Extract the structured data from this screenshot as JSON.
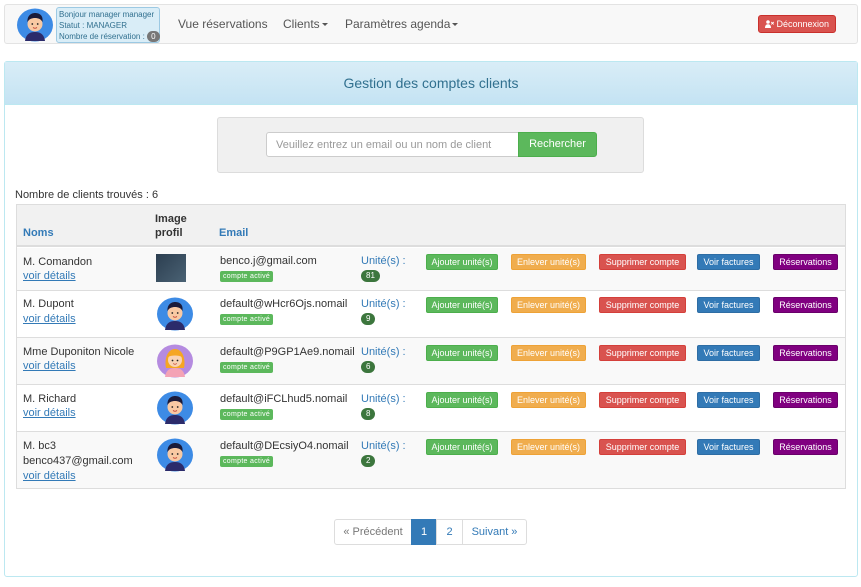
{
  "nav": {
    "greeting": "Bonjour manager manager",
    "status": "Statut : MANAGER",
    "reservations_label": "Nombre de réservation :",
    "reservations_count": "0",
    "link_reservations": "Vue réservations",
    "link_clients": "Clients",
    "link_agenda": "Paramètres agenda",
    "logout": "Déconnexion"
  },
  "panel": {
    "title": "Gestion des comptes clients"
  },
  "search": {
    "placeholder": "Veuillez entrez un email ou un nom de client",
    "button": "Rechercher"
  },
  "results": {
    "count_text": "Nombre de clients trouvés : 6"
  },
  "table": {
    "headers": {
      "name": "Noms",
      "image_line1": "Image",
      "image_line2": "profil",
      "email": "Email"
    },
    "units_label": "Unité(s) :",
    "details_link": "voir détails",
    "active_badge": "compte activé",
    "actions": {
      "add": "Ajouter unité(s)",
      "remove": "Enlever unité(s)",
      "delete": "Supprimer compte",
      "invoices": "Voir factures",
      "reservations": "Réservations"
    },
    "rows": [
      {
        "name": "M. Comandon",
        "email": "benco.j@gmail.com",
        "units": "81"
      },
      {
        "name": "M. Dupont",
        "email": "default@wHcr6Ojs.nomail",
        "units": "9"
      },
      {
        "name": "Mme Duponiton Nicole",
        "email": "default@P9GP1Ae9.nomail",
        "units": "6"
      },
      {
        "name": "M. Richard",
        "email": "default@iFCLhud5.nomail",
        "units": "8"
      },
      {
        "name": "M. bc3",
        "name_line2": "benco437@gmail.com",
        "email": "default@DEcsiyO4.nomail",
        "units": "2"
      }
    ]
  },
  "pagination": {
    "prev": "« Précédent",
    "page1": "1",
    "page2": "2",
    "next": "Suivant »"
  },
  "colors": {
    "primary": "#337ab7",
    "success": "#5cb85c",
    "warning": "#f0ad4e",
    "danger": "#d9534f",
    "purple": "#800080"
  }
}
